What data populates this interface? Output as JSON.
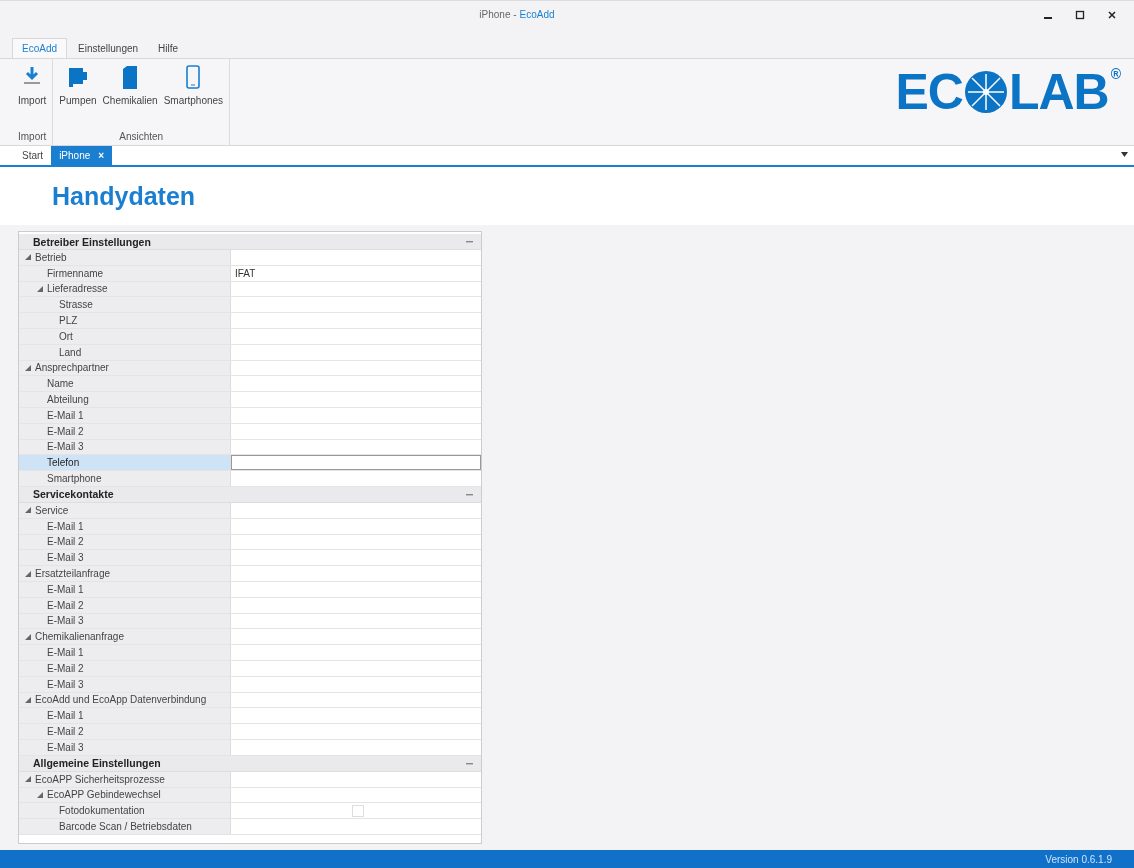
{
  "window": {
    "document": "iPhone -",
    "app": "EcoAdd"
  },
  "menu_tabs": [
    {
      "label": "EcoAdd",
      "selected": true
    },
    {
      "label": "Einstellungen",
      "selected": false
    },
    {
      "label": "Hilfe",
      "selected": false
    }
  ],
  "ribbon_groups": [
    {
      "label": "Import",
      "buttons": [
        {
          "label": "Import",
          "kind": "download"
        }
      ]
    },
    {
      "label": "Ansichten",
      "buttons": [
        {
          "label": "Pumpen",
          "kind": "pump"
        },
        {
          "label": "Chemikalien",
          "kind": "canister"
        },
        {
          "label": "Smartphones",
          "kind": "phone"
        }
      ]
    }
  ],
  "logo": {
    "left": "EC",
    "right": "LAB",
    "mark": "®"
  },
  "doc_tabs": [
    {
      "label": "Start",
      "selected": false
    },
    {
      "label": "iPhone",
      "selected": true,
      "close": "×"
    }
  ],
  "page_title": "Handydaten",
  "sections": [
    {
      "title": "Betreiber Einstellungen",
      "expanded": true,
      "items": [
        {
          "label": "Betrieb",
          "expanded": true,
          "children": [
            {
              "label": "Firmenname",
              "kind": "text",
              "value": "IFAT",
              "selected": false
            },
            {
              "label": "Lieferadresse",
              "expanded": true,
              "children": [
                {
                  "label": "Strasse",
                  "kind": "text",
                  "selected": false
                },
                {
                  "label": "PLZ",
                  "kind": "text",
                  "selected": false
                },
                {
                  "label": "Ort",
                  "kind": "text",
                  "selected": false
                },
                {
                  "label": "Land",
                  "kind": "text",
                  "selected": false
                }
              ]
            }
          ]
        },
        {
          "label": "Ansprechpartner",
          "expanded": true,
          "children": [
            {
              "label": "Name",
              "kind": "text",
              "selected": false
            },
            {
              "label": "Abteilung",
              "kind": "text",
              "selected": false
            },
            {
              "label": "E-Mail 1",
              "kind": "text",
              "selected": false
            },
            {
              "label": "E-Mail 2",
              "kind": "text",
              "selected": false
            },
            {
              "label": "E-Mail 3",
              "kind": "text",
              "selected": false
            },
            {
              "label": "Telefon",
              "kind": "text",
              "selected": true
            },
            {
              "label": "Smartphone",
              "kind": "text",
              "selected": false
            }
          ]
        }
      ]
    },
    {
      "title": "Servicekontakte",
      "expanded": true,
      "items": [
        {
          "label": "Service",
          "expanded": true,
          "children": [
            {
              "label": "E-Mail 1",
              "kind": "text",
              "selected": false
            },
            {
              "label": "E-Mail 2",
              "kind": "text",
              "selected": false
            },
            {
              "label": "E-Mail 3",
              "kind": "text",
              "selected": false
            }
          ]
        },
        {
          "label": "Ersatzteilanfrage",
          "expanded": true,
          "children": [
            {
              "label": "E-Mail 1",
              "kind": "text",
              "selected": false
            },
            {
              "label": "E-Mail 2",
              "kind": "text",
              "selected": false
            },
            {
              "label": "E-Mail 3",
              "kind": "text",
              "selected": false
            }
          ]
        },
        {
          "label": "Chemikalienanfrage",
          "expanded": true,
          "children": [
            {
              "label": "E-Mail 1",
              "kind": "text",
              "selected": false
            },
            {
              "label": "E-Mail 2",
              "kind": "text",
              "selected": false
            },
            {
              "label": "E-Mail 3",
              "kind": "text",
              "selected": false
            }
          ]
        },
        {
          "label": "EcoAdd und EcoApp Datenverbindung",
          "expanded": true,
          "children": [
            {
              "label": "E-Mail 1",
              "kind": "text",
              "selected": false
            },
            {
              "label": "E-Mail 2",
              "kind": "text",
              "selected": false
            },
            {
              "label": "E-Mail 3",
              "kind": "text",
              "selected": false
            }
          ]
        }
      ]
    },
    {
      "title": "Allgemeine Einstellungen",
      "expanded": true,
      "items": [
        {
          "label": "EcoAPP Sicherheitsprozesse",
          "expanded": true,
          "children": [
            {
              "label": "EcoAPP Gebindewechsel",
              "expanded": true,
              "children": [
                {
                  "label": "Fotodokumentation",
                  "kind": "checkbox",
                  "checked": false,
                  "selected": false
                },
                {
                  "label": "Barcode Scan / Betriebsdaten",
                  "kind": "text",
                  "selected": false
                }
              ]
            }
          ]
        }
      ]
    }
  ],
  "status_bar": {
    "version": "Version 0.6.1.9"
  }
}
